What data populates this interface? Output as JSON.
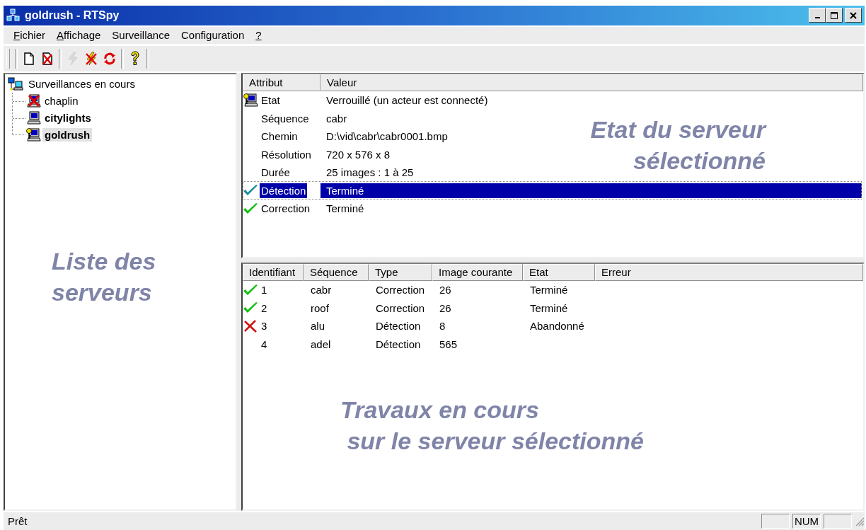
{
  "window": {
    "title": "goldrush - RTSpy"
  },
  "menu": [
    {
      "label": "Fichier",
      "underline_first": true
    },
    {
      "label": "Affichage",
      "underline_first": true
    },
    {
      "label": "Surveillance",
      "underline_first": false
    },
    {
      "label": "Configuration",
      "underline_first": false
    },
    {
      "label": "?",
      "underline_first": true
    }
  ],
  "toolbar": [
    [
      {
        "kind": "new",
        "disabled": false
      },
      {
        "kind": "delete",
        "disabled": false
      }
    ],
    [
      {
        "kind": "connect",
        "disabled": true
      },
      {
        "kind": "disconnect",
        "disabled": false
      },
      {
        "kind": "refresh",
        "disabled": false
      }
    ],
    [
      {
        "kind": "help",
        "disabled": false
      }
    ]
  ],
  "tree": {
    "label": "Surveillances en cours",
    "children": [
      {
        "label": "chaplin",
        "kind": "offline",
        "connected": false,
        "selected": false
      },
      {
        "label": "citylights",
        "kind": "online",
        "connected": true,
        "selected": false
      },
      {
        "label": "goldrush",
        "kind": "locked",
        "connected": true,
        "selected": true
      }
    ]
  },
  "attributes": {
    "columns": [
      "Attribut",
      "Valeur"
    ],
    "rows": [
      {
        "attribute": "Etat",
        "value": "Verrouillé (un acteur est connecté)",
        "kind": "locked",
        "selected": false
      },
      {
        "attribute": "Séquence",
        "value": "cabr",
        "kind": "plain",
        "selected": false
      },
      {
        "attribute": "Chemin",
        "value": "D:\\vid\\cabr\\cabr0001.bmp",
        "kind": "plain",
        "selected": false
      },
      {
        "attribute": "Résolution",
        "value": "720 x 576 x 8",
        "kind": "plain",
        "selected": false
      },
      {
        "attribute": "Durée",
        "value": "25 images : 1 à 25",
        "kind": "plain",
        "selected": false
      },
      {
        "attribute": "Détection",
        "value": "Terminé",
        "kind": "done",
        "selected": true
      },
      {
        "attribute": "Correction",
        "value": "Terminé",
        "kind": "done",
        "selected": false
      }
    ]
  },
  "jobs": {
    "columns": [
      "Identifiant",
      "Séquence",
      "Type",
      "Image courante",
      "Etat",
      "Erreur"
    ],
    "rows": [
      {
        "kind": "done",
        "cells": [
          "1",
          "cabr",
          "Correction",
          "26",
          "Terminé"
        ]
      },
      {
        "kind": "done",
        "cells": [
          "2",
          "roof",
          "Correction",
          "26",
          "Terminé"
        ]
      },
      {
        "kind": "aborted",
        "cells": [
          "3",
          "alu",
          "Détection",
          "8",
          "Abandonné"
        ]
      },
      {
        "kind": "pending",
        "cells": [
          "4",
          "adel",
          "Détection",
          "565"
        ]
      }
    ]
  },
  "annotations": [
    {
      "lines": [
        "Liste des",
        "serveurs"
      ]
    },
    {
      "lines": [
        "Etat du serveur",
        "sélectionné"
      ]
    },
    {
      "lines": [
        "Travaux en cours",
        " sur le serveur sélectionné"
      ]
    }
  ],
  "status_bar": {
    "text": "Prêt",
    "panels": [
      {
        "kind": "blank"
      },
      {
        "kind": "text",
        "text": "NUM"
      },
      {
        "kind": "blank"
      }
    ]
  }
}
